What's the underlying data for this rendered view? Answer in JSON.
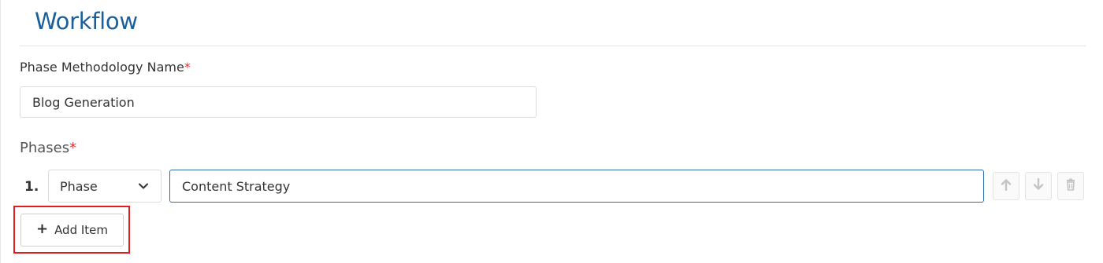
{
  "header": {
    "title": "Workflow"
  },
  "form": {
    "name_label": "Phase Methodology Name",
    "required_mark": "*",
    "name_value": "Blog Generation",
    "phases_label": "Phases",
    "phases": [
      {
        "index": "1.",
        "type": "Phase",
        "name": "Content Strategy"
      }
    ],
    "add_item_label": "Add Item"
  },
  "icons": {
    "move_up": "arrow-up-icon",
    "move_down": "arrow-down-icon",
    "delete": "trash-icon",
    "dropdown": "chevron-down-icon",
    "add": "plus-icon"
  },
  "colors": {
    "title": "#1a5f9e",
    "required": "#dd3333",
    "focus_border": "#2c6db1",
    "highlight": "#e01e1e"
  }
}
